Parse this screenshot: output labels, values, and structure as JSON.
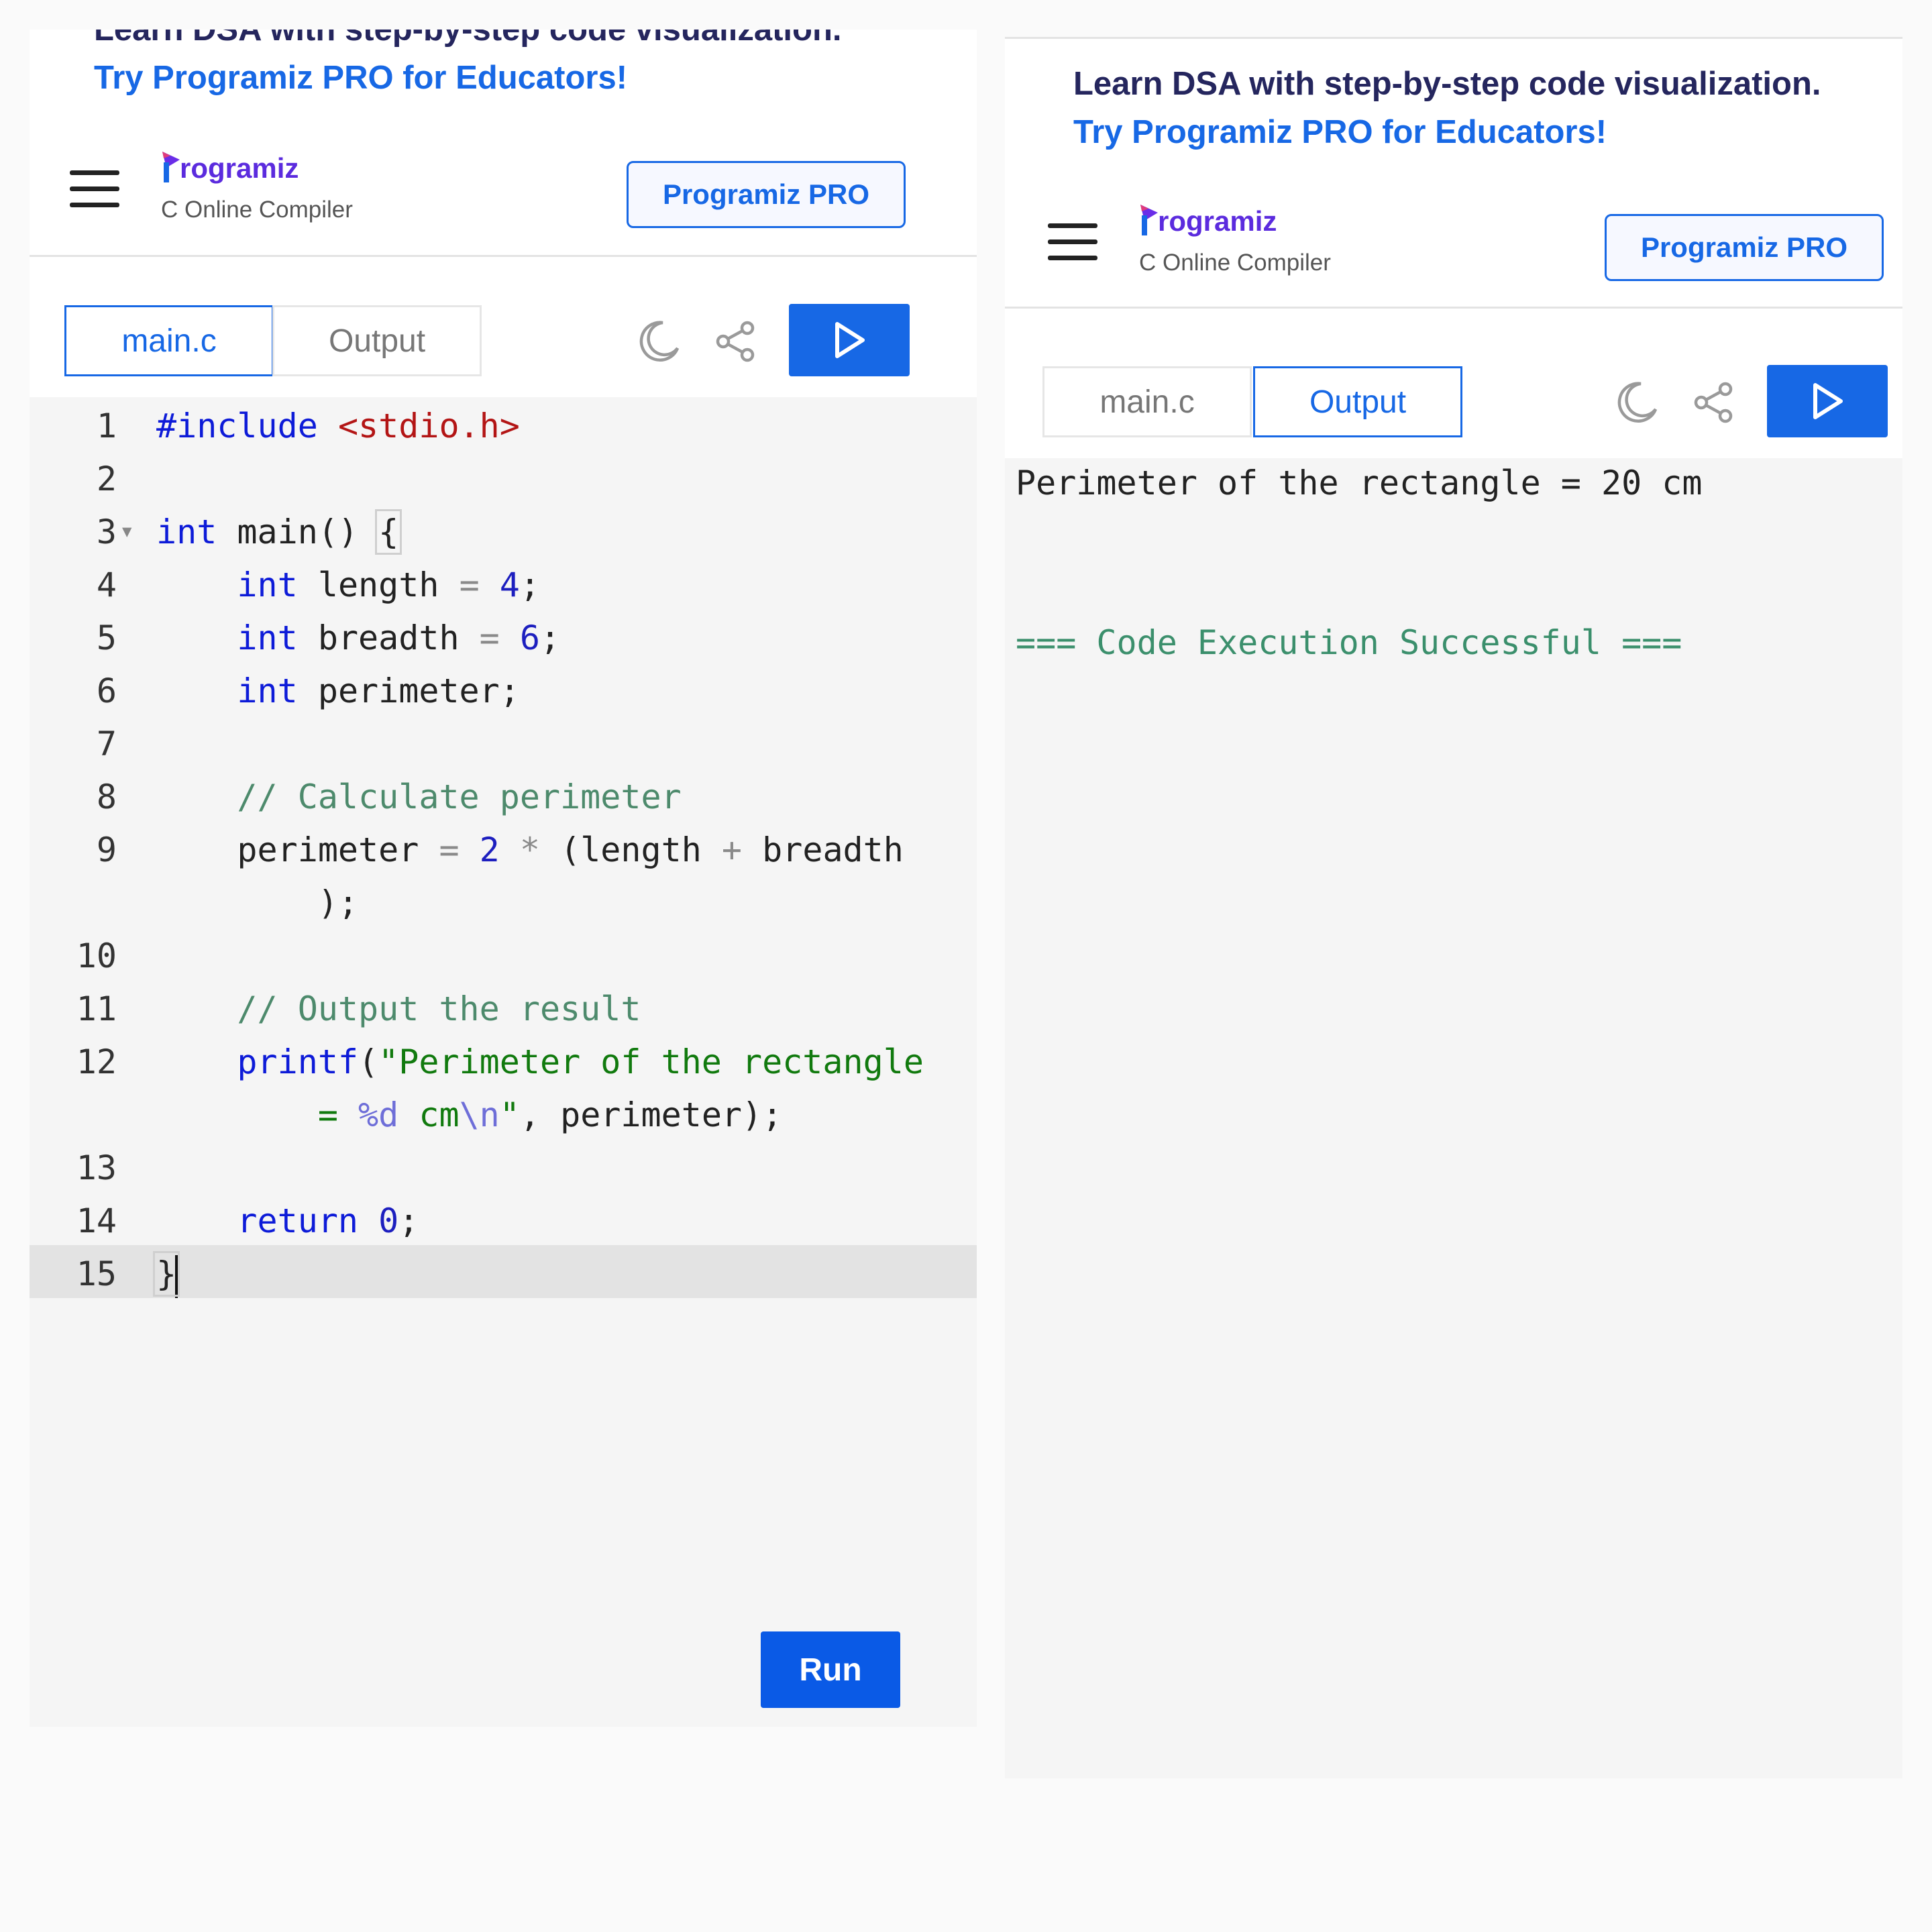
{
  "promo": {
    "line1": "Learn DSA with step-by-step code visualization.",
    "line2": "Try Programiz PRO for Educators!"
  },
  "header": {
    "brand": "rogramiz",
    "subtitle": "C Online Compiler",
    "pro_button": "Programiz PRO"
  },
  "tabs": {
    "file": "main.c",
    "output": "Output"
  },
  "icons": {
    "menu": "hamburger-menu-icon",
    "theme": "moon-icon",
    "share": "share-icon",
    "run": "play-icon",
    "logo": "programiz-logo-icon"
  },
  "colors": {
    "accent": "#1768e5",
    "brand": "#5b2bde",
    "success": "#3b8f6c"
  },
  "code_lines": [
    "#include <stdio.h>",
    "",
    "int main() {",
    "    int length = 4;",
    "    int breadth = 6;",
    "    int perimeter;",
    "",
    "    // Calculate perimeter",
    "    perimeter = 2 * (length + breadth",
    "        );",
    "",
    "    // Output the result",
    "    printf(\"Perimeter of the rectangle",
    "        = %d cm\\n\", perimeter);",
    "",
    "    return 0;",
    "}"
  ],
  "line_numbers": [
    "1",
    "2",
    "3",
    "4",
    "5",
    "6",
    "7",
    "8",
    "9",
    "",
    "10",
    "11",
    "12",
    "",
    "13",
    "14",
    "15"
  ],
  "run_button": "Run",
  "output": {
    "line1": "Perimeter of the rectangle = 20 cm",
    "line2": "=== Code Execution Successful ==="
  }
}
